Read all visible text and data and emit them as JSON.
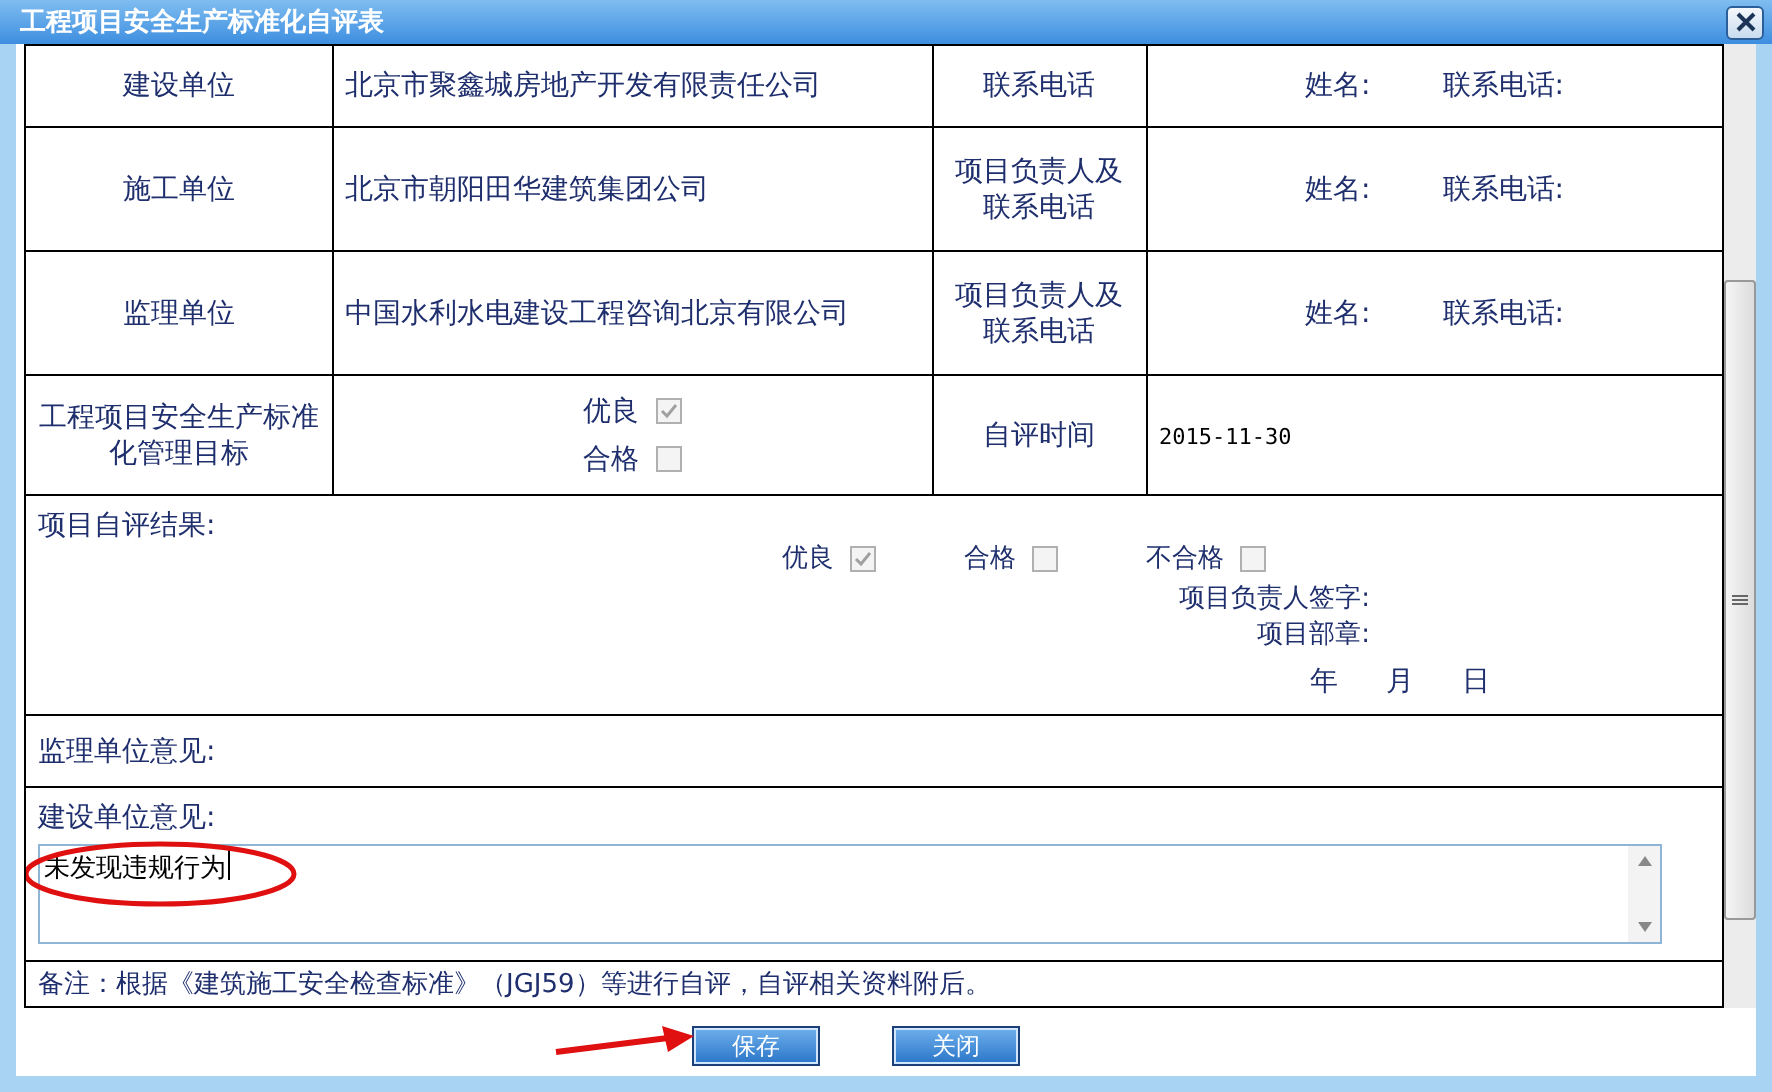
{
  "window": {
    "title": "工程项目安全生产标准化自评表"
  },
  "units": [
    {
      "label": "建设单位",
      "company": "北京市聚鑫城房地产开发有限责任公司",
      "contact_label": "联系电话",
      "name_label": "姓名:",
      "phone_label": "联系电话:"
    },
    {
      "label": "施工单位",
      "company": "北京市朝阳田华建筑集团公司",
      "contact_label": "项目负责人及联系电话",
      "name_label": "姓名:",
      "phone_label": "联系电话:"
    },
    {
      "label": "监理单位",
      "company": "中国水利水电建设工程咨询北京有限公司",
      "contact_label": "项目负责人及联系电话",
      "name_label": "姓名:",
      "phone_label": "联系电话:"
    }
  ],
  "target": {
    "label": "工程项目安全生产标准化管理目标",
    "options": [
      {
        "label": "优良",
        "checked": true,
        "disabled": true
      },
      {
        "label": "合格",
        "checked": false,
        "disabled": true
      }
    ],
    "time_label": "自评时间",
    "time_value": "2015-11-30"
  },
  "self_evaluation": {
    "label": "项目自评结果:",
    "options": [
      {
        "label": "优良",
        "checked": true,
        "disabled": true
      },
      {
        "label": "合格",
        "checked": false,
        "disabled": true
      },
      {
        "label": "不合格",
        "checked": false,
        "disabled": true
      }
    ],
    "signature_lines": [
      "项目负责人签字:",
      "项目部章:"
    ],
    "date_parts": [
      "年",
      "月",
      "日"
    ]
  },
  "supervisor_opinion": {
    "label": "监理单位意见:"
  },
  "owner_opinion": {
    "label": "建设单位意见:",
    "value": "未发现违规行为",
    "circled": true
  },
  "note": "备注：根据《建筑施工安全检查标准》（JGJ59）等进行自评，自评相关资料附后。",
  "buttons": [
    {
      "label": "保存",
      "arrow_pointed": true
    },
    {
      "label": "关闭",
      "arrow_pointed": false
    }
  ]
}
